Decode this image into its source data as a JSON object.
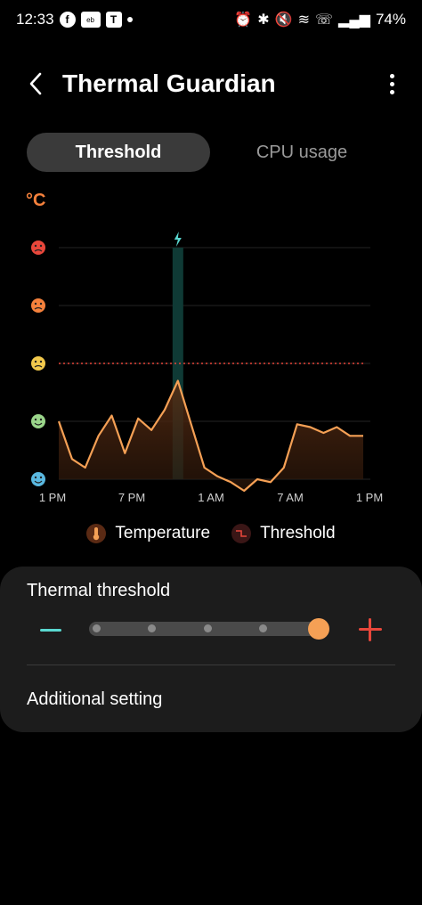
{
  "status": {
    "time": "12:33",
    "battery": "74%",
    "left_icons": [
      "facebook-icon",
      "ebay-icon",
      "teams-icon"
    ],
    "right_icons": [
      "alarm-icon",
      "bluetooth-icon",
      "mute-icon",
      "wifi-icon",
      "call-icon",
      "signal-icon"
    ]
  },
  "header": {
    "title": "Thermal Guardian"
  },
  "tabs": [
    {
      "label": "Threshold",
      "active": true
    },
    {
      "label": "CPU usage",
      "active": false
    }
  ],
  "chart": {
    "unit_label": "°C",
    "y_levels": [
      "hot-face-icon",
      "sweat-face-icon",
      "uneasy-face-icon",
      "smile-face-icon",
      "cool-face-icon"
    ],
    "highlight_icon": "lightning-icon"
  },
  "chart_data": {
    "type": "area",
    "x_ticks": [
      "1 PM",
      "7 PM",
      "1 AM",
      "7 AM",
      "1 PM"
    ],
    "y_levels_count": 5,
    "threshold_level": 2,
    "highlight_index": 9,
    "temperature_level": [
      1.0,
      0.35,
      0.2,
      0.75,
      1.1,
      0.45,
      1.05,
      0.85,
      1.2,
      1.7,
      0.95,
      0.2,
      0.05,
      -0.05,
      -0.2,
      0.0,
      -0.05,
      0.2,
      0.95,
      0.9,
      0.8,
      0.9,
      0.75,
      0.75
    ],
    "colors": {
      "temperature": "#f5a055",
      "threshold": "#e8473b",
      "highlight": "#0f3a35"
    }
  },
  "legend": {
    "temperature": "Temperature",
    "threshold": "Threshold"
  },
  "card": {
    "title": "Thermal threshold",
    "slider_steps": 5,
    "slider_value": 5,
    "additional": "Additional setting"
  }
}
